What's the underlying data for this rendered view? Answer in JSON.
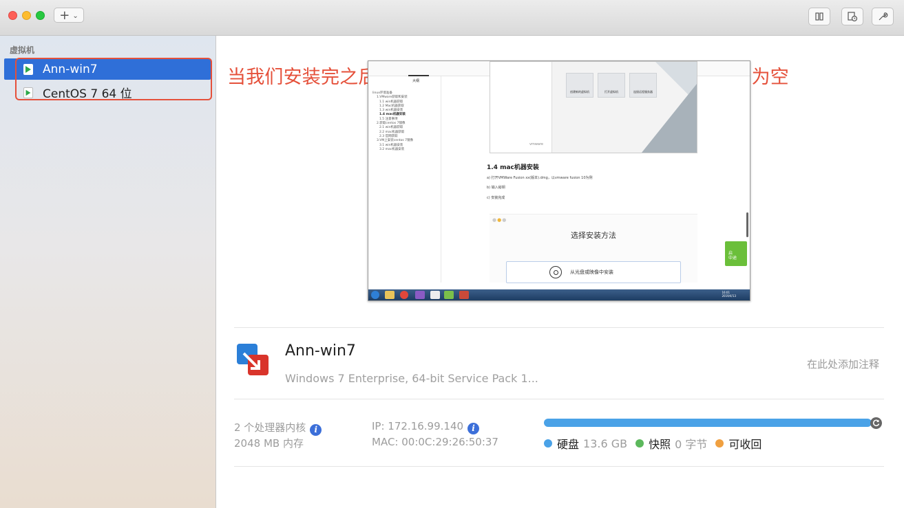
{
  "toolbar": {
    "add_label": "+",
    "icons": [
      "columns-icon",
      "snapshot-icon",
      "wrench-icon"
    ]
  },
  "sidebar": {
    "heading": "虚拟机",
    "items": [
      {
        "label": "Ann-win7",
        "selected": true
      },
      {
        "label": "CentOS 7 64 位",
        "selected": false
      }
    ]
  },
  "annotation": "当我们安装完之后，还是没有虚拟机资源的，左边红色框中应该为空",
  "preview": {
    "tab": "大纲",
    "toc": [
      "linux环境准备",
      "1.VMware获取和安装",
      "1.1 win机器获取",
      "1.2 Mac机器获取",
      "1.3 win机器安装",
      "1.4 mac机器安装",
      "1.5 注意事项",
      "2.获取centos 7镜像",
      "2.1 win机器获取",
      "2.2 mac机器获取",
      "2.3 官网获取",
      "3.VM上安装centos 7镜像",
      "3.1 win机器安装",
      "3.2 mac机器安装"
    ],
    "cards": [
      "创建新的虚拟机",
      "打开虚拟机",
      "连接远程服务器"
    ],
    "vm_logo": "vmware",
    "heading": "1.4 mac机器安装",
    "lines": [
      "a) 打开VMWare Fusion xx(版本).dmg，以vmware fusion 10为例",
      "b) 输入秘钥",
      "c) 安装完成"
    ],
    "dialog_title": "选择安装方法",
    "install_option": "从光盘或映像中安装",
    "badge": "启\n中途",
    "clock": "16:01\n2019/4/13"
  },
  "vm": {
    "name": "Ann-win7",
    "description": "Windows 7 Enterprise, 64-bit Service Pack 1...",
    "note_placeholder": "在此处添加注释",
    "cpu": "2 个处理器内核",
    "memory": "2048 MB 内存",
    "ip": "IP: 172.16.99.140",
    "mac": "MAC: 00:0C:29:26:50:37"
  },
  "storage": {
    "disk_label": "硬盘",
    "disk_value": "13.6 GB",
    "snapshot_label": "快照",
    "snapshot_value": "0 字节",
    "reclaim_label": "可收回",
    "disk_fraction": 1.0,
    "colors": {
      "disk": "#4aa2e7",
      "snapshot": "#5cb85c",
      "reclaim": "#f0a040"
    }
  }
}
